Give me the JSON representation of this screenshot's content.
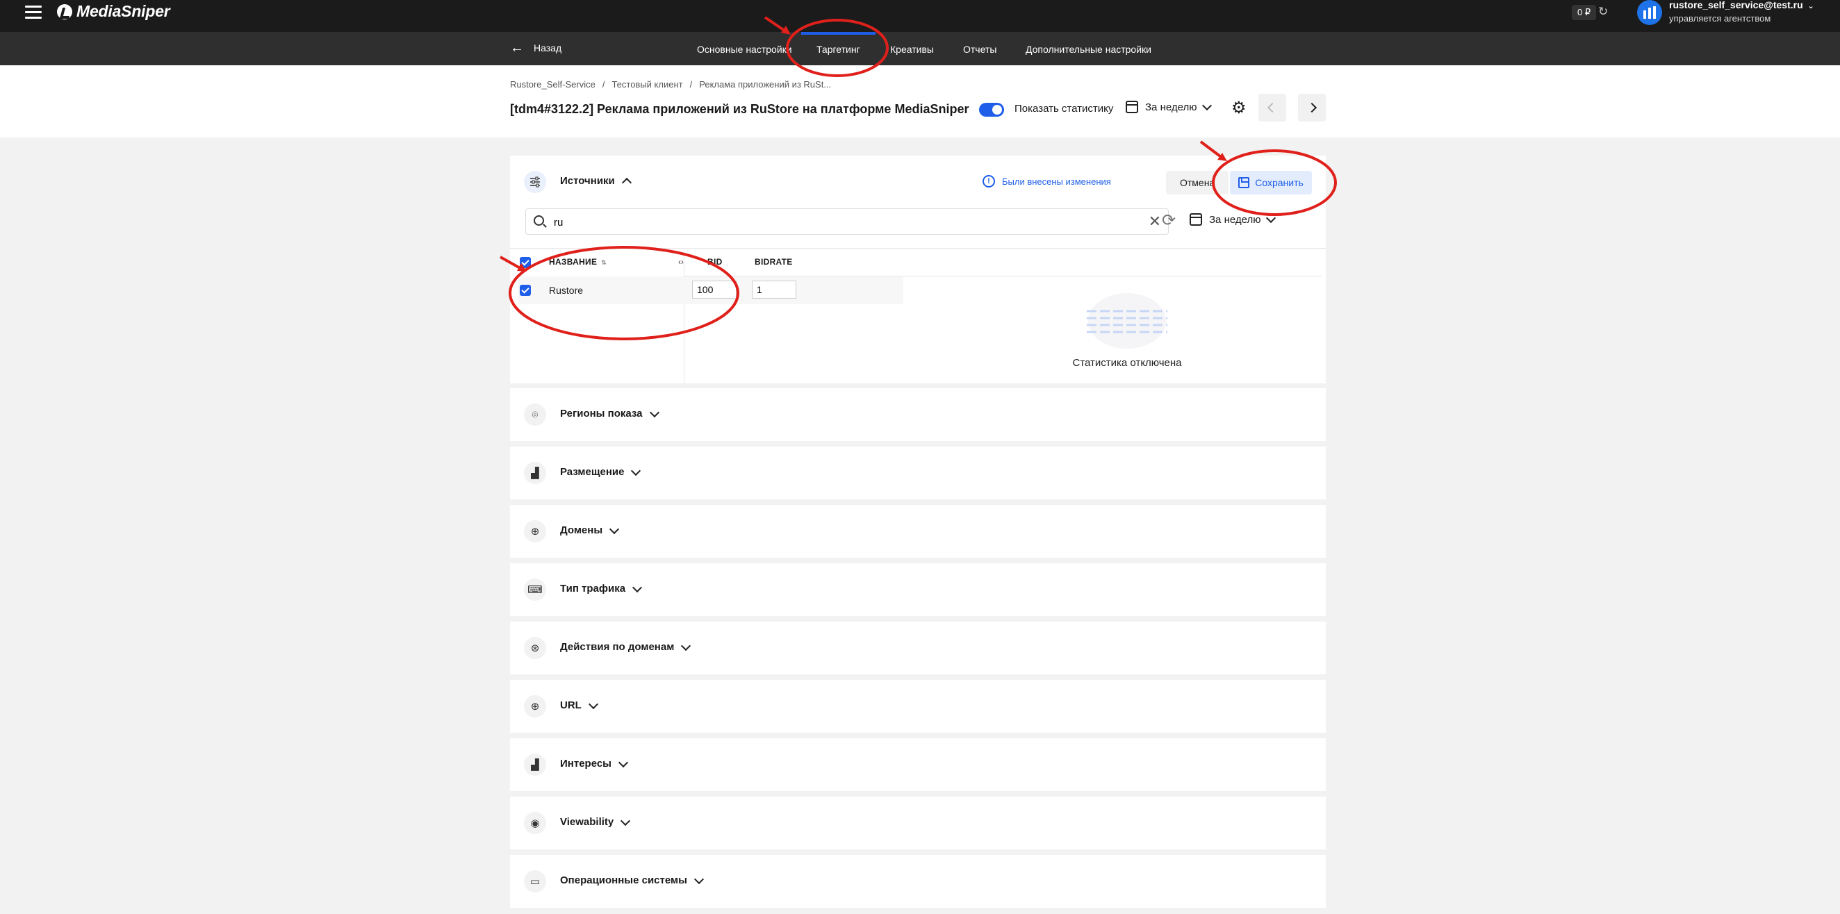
{
  "topbar": {
    "logo_text": "MediaSniper",
    "balance": "0 ₽",
    "user_email": "rustore_self_service@test.ru",
    "user_sub": "управляется агентством",
    "icons": [
      "menu-icon",
      "refresh-icon",
      "avatar-icon",
      "chevron-down-icon"
    ]
  },
  "navbar": {
    "back_label": "Назад",
    "tabs": [
      {
        "label": "Основные настройки",
        "active": false
      },
      {
        "label": "Таргетинг",
        "active": true
      },
      {
        "label": "Креативы",
        "active": false
      },
      {
        "label": "Отчеты",
        "active": false
      },
      {
        "label": "Дополнительные настройки",
        "active": false
      }
    ]
  },
  "header": {
    "breadcrumbs": [
      "Rustore_Self-Service",
      "Тестовый клиент",
      "Реклама приложений из RuSt..."
    ],
    "title": "[tdm4#3122.2] Реклама приложений из RuStore на платформе MediaSniper",
    "show_stats_label": "Показать статистику",
    "show_stats_on": true,
    "period": "За неделю"
  },
  "sources": {
    "title": "Источники",
    "changed_notice": "Были внесены изменения",
    "cancel_label": "Отмена",
    "save_label": "Сохранить",
    "search_value": "ru",
    "search_placeholder": "",
    "period": "За неделю",
    "columns": {
      "name": "НАЗВАНИЕ",
      "bid": "BID",
      "bidrate": "BIDRATE"
    },
    "rows": [
      {
        "name": "Rustore",
        "checked": true,
        "bid": "100",
        "bidrate": "1"
      }
    ],
    "stats_disabled_text": "Статистика отключена"
  },
  "sections": [
    {
      "title": "Регионы показа",
      "icon": "location-pin-icon",
      "glyph": "⌾"
    },
    {
      "title": "Размещение",
      "icon": "bar-chart-icon",
      "glyph": "▟"
    },
    {
      "title": "Домены",
      "icon": "globe-icon",
      "glyph": "⊕"
    },
    {
      "title": "Тип трафика",
      "icon": "device-icon",
      "glyph": "⌨"
    },
    {
      "title": "Действия по доменам",
      "icon": "globe-action-icon",
      "glyph": "⊛"
    },
    {
      "title": "URL",
      "icon": "globe-icon",
      "glyph": "⊕"
    },
    {
      "title": "Интересы",
      "icon": "bar-chart-icon",
      "glyph": "▟"
    },
    {
      "title": "Viewability",
      "icon": "eye-icon",
      "glyph": "◉"
    },
    {
      "title": "Операционные системы",
      "icon": "monitor-icon",
      "glyph": "▭"
    }
  ],
  "colors": {
    "accent": "#1e5ee8",
    "topbar": "#1b1b1b",
    "navbar": "#2f2f2f",
    "annotation": "#e0201b"
  }
}
